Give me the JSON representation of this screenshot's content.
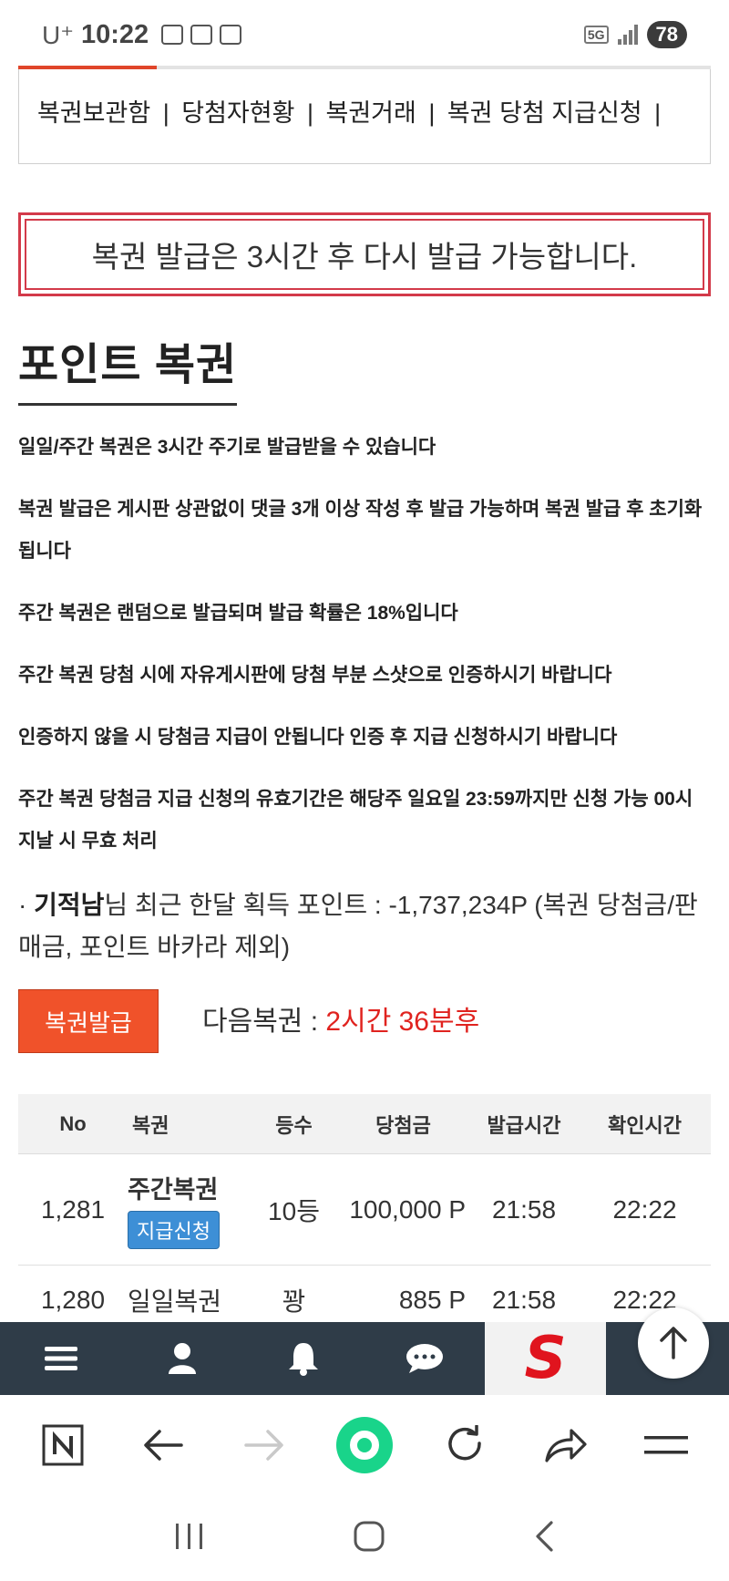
{
  "status": {
    "carrier": "U⁺",
    "time": "10:22",
    "network": "5G",
    "battery": "78"
  },
  "load_progress": 0.2,
  "nav": {
    "items": [
      "복권보관함",
      "당첨자현황",
      "복권거래",
      "복권 당첨 지급신청"
    ],
    "separator": "|"
  },
  "notice": "복권 발급은 3시간 후 다시 발급 가능합니다.",
  "title": "포인트 복권",
  "rules": [
    "일일/주간 복권은 3시간 주기로 발급받을 수 있습니다",
    "복권 발급은 게시판 상관없이 댓글 3개 이상 작성 후 발급 가능하며 복권 발급 후 초기화됩니다",
    "주간 복권은 랜덤으로 발급되며 발급 확률은 18%입니다",
    "주간 복권 당첨 시에 자유게시판에 당첨 부분 스샷으로 인증하시기 바랍니다",
    "인증하지 않을 시 당첨금 지급이 안됩니다 인증 후 지급 신청하시기 바랍니다",
    "주간 복권 당첨금 지급 신청의 유효기간은 해당주 일요일 23:59까지만 신청 가능 00시 지날 시 무효 처리"
  ],
  "points": {
    "bullet": "·",
    "user": "기적남",
    "text": "님 최근 한달 획득 포인트 : -1,737,234P (복권 당첨금/판매금, 포인트 바카라 제외)"
  },
  "issue": {
    "button_label": "복권발급",
    "next_label": "다음복권 : ",
    "next_value": "2시간 36분후"
  },
  "table": {
    "headers": [
      "No",
      "복권",
      "등수",
      "당첨금",
      "발급시간",
      "확인시간"
    ],
    "rows": [
      {
        "no": "1,281",
        "name": "주간복권",
        "action": "지급신청",
        "rank": "10등",
        "prize": "100,000 P",
        "issued": "21:58",
        "checked": "22:22"
      },
      {
        "no": "1,280",
        "name": "일일복권",
        "rank": "꽝",
        "prize": "885 P",
        "issued": "21:58",
        "checked": "22:22"
      }
    ]
  },
  "colors": {
    "accent_red": "#d33a4a",
    "issue_button": "#f0522a",
    "next_value": "#e0231f",
    "pay_button": "#3d8fd6",
    "app_bar": "#2f3c48",
    "browser_green": "#19d48a"
  },
  "icons": {
    "app_bar": [
      "menu-icon",
      "user-icon",
      "bell-icon",
      "chat-icon",
      "logo-s"
    ],
    "browser": [
      "naver-n-icon",
      "back-arrow-icon",
      "forward-arrow-icon",
      "home-circle-icon",
      "refresh-icon",
      "share-icon",
      "menu-lines-icon"
    ],
    "system": [
      "recent-apps-icon",
      "home-icon",
      "back-icon"
    ]
  },
  "app_logo_letter": "S"
}
